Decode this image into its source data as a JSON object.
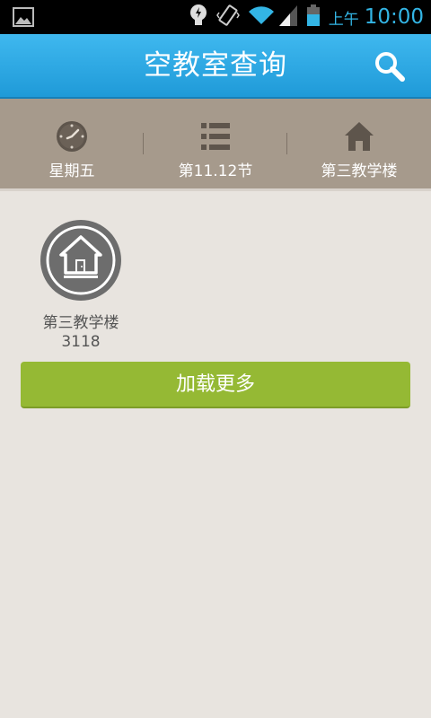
{
  "status_bar": {
    "ampm": "上午",
    "time": "10:00",
    "icons": [
      "gallery-icon",
      "bulb-icon",
      "vibrate-icon",
      "wifi-icon",
      "signal-icon",
      "battery-icon"
    ]
  },
  "title_bar": {
    "title": "空教室查询",
    "search_icon": "search-icon"
  },
  "filters": [
    {
      "icon": "clock-icon",
      "label": "星期五"
    },
    {
      "icon": "list-icon",
      "label": "第11.12节"
    },
    {
      "icon": "house-icon",
      "label": "第三教学楼"
    }
  ],
  "rooms": [
    {
      "icon": "house-icon",
      "label": "第三教学楼3118"
    }
  ],
  "load_more": {
    "label": "加载更多"
  },
  "colors": {
    "title_bar": "#29a7e4",
    "filter_bar": "#a69a8c",
    "background": "#e8e4df",
    "load_more": "#95b934",
    "status_accent": "#33b5e5"
  }
}
